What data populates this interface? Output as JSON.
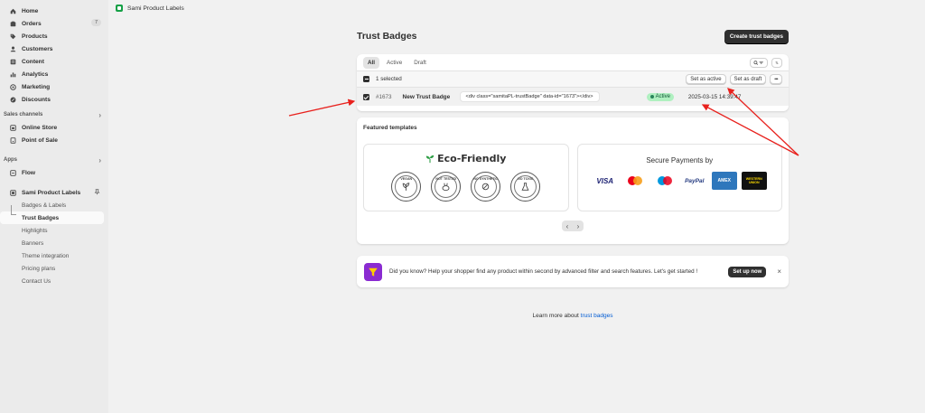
{
  "nav": {
    "items": [
      {
        "label": "Home",
        "icon": "home-icon"
      },
      {
        "label": "Orders",
        "icon": "orders-icon",
        "count": "7"
      },
      {
        "label": "Products",
        "icon": "tag-icon"
      },
      {
        "label": "Customers",
        "icon": "person-icon"
      },
      {
        "label": "Content",
        "icon": "content-icon"
      },
      {
        "label": "Analytics",
        "icon": "analytics-icon"
      },
      {
        "label": "Marketing",
        "icon": "target-icon"
      },
      {
        "label": "Discounts",
        "icon": "discount-icon"
      }
    ],
    "sales_channels_label": "Sales channels",
    "channels": [
      {
        "label": "Online Store",
        "icon": "store-icon"
      },
      {
        "label": "Point of Sale",
        "icon": "pos-icon"
      }
    ],
    "apps_label": "Apps",
    "apps": [
      {
        "label": "Flow",
        "icon": "flow-icon"
      }
    ],
    "app_name": "Sami Product Labels",
    "app_sub": [
      "Badges & Labels",
      "Trust Badges",
      "Highlights",
      "Banners",
      "Theme integration",
      "Pricing plans",
      "Contact Us"
    ]
  },
  "topbar": {
    "title": "Sami Product Labels"
  },
  "page": {
    "title": "Trust Badges",
    "create_button": "Create trust badges",
    "tabs": [
      "All",
      "Active",
      "Draft"
    ],
    "selected_text": "1 selected",
    "set_active": "Set as active",
    "set_draft": "Set as draft",
    "more": "•••",
    "row": {
      "id": "#1673",
      "name": "New Trust Badge",
      "code": "<div class=\"samitaPL-trustBadge\" data-id=\"1673\"></div>",
      "status": "Active",
      "date": "2025-03-15 14:39:47"
    },
    "featured_title": "Featured templates",
    "eco": {
      "title": "Eco-Friendly",
      "badges": [
        "VEGAN",
        "NOT TESTED",
        "NO SYNTHETIC",
        "NO TOXIC"
      ]
    },
    "pay": {
      "title": "Secure Payments by",
      "logos": [
        "VISA",
        "MC",
        "MAESTRO",
        "PayPal",
        "AMEX",
        "WESTERN UNION"
      ]
    },
    "tip": {
      "text": "Did you know? Help your shopper find any product within second by advanced filter and search features. Let's get started !",
      "button": "Set up now",
      "close": "×"
    },
    "learn_prefix": "Learn more about",
    "learn_link": "trust badges"
  },
  "colors": {
    "accent": "#303030",
    "active_bg": "#aff0c0",
    "link": "#005bd3",
    "arrow": "#e8211d"
  }
}
